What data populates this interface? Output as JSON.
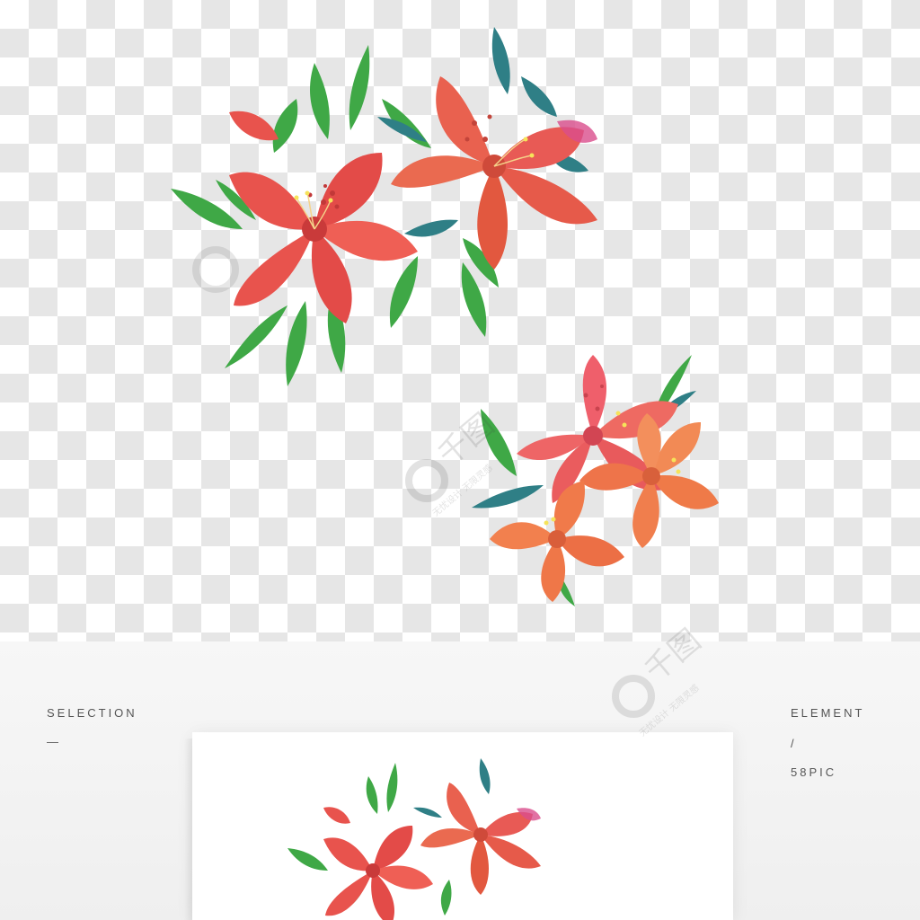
{
  "panel": {
    "left_label": "SELECTION",
    "left_dash": "—",
    "right_label": "ELEMENT",
    "right_slash": "/",
    "right_site": "58PIC"
  },
  "watermark": {
    "logo_text": "千图",
    "tagline": "无忧设计 无限灵感"
  },
  "colors": {
    "checker_dark": "#e6e6e6",
    "checker_light": "#ffffff",
    "petal_red": "#e8534d",
    "petal_coral": "#f07a4a",
    "petal_pink": "#ef5f6b",
    "leaf_green": "#3fa846",
    "leaf_teal": "#2f7f86"
  },
  "icons": {
    "flower_cluster_top": "red-azalea-cluster",
    "flower_cluster_bottom": "coral-azalea-cluster",
    "watermark_logo": "qiantu-logo"
  }
}
